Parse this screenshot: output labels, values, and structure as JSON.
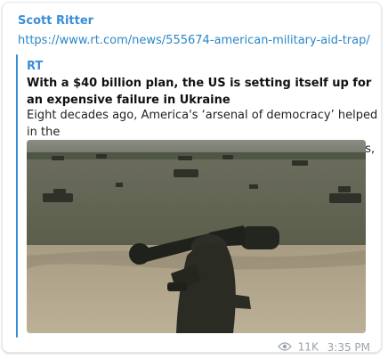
{
  "message": {
    "sender": "Scott Ritter",
    "link_text": "https://www.rt.com/news/555674-american-military-aid-trap/",
    "views": "11K",
    "time": "3:35 PM"
  },
  "preview": {
    "site_name": "RT",
    "title": "With a $40 billion plan, the US is setting itself up for an expensive failure in Ukraine",
    "description": "Eight decades ago, America's ‘arsenal of democracy’ helped in the\ndefeat of Nazi Germany and Imperial Japan. In recent years, how..."
  },
  "colors": {
    "accent": "#3a8fd6",
    "link": "#2a87c8",
    "meta": "#9aa3ab"
  },
  "icons": {
    "views": "eye-icon"
  }
}
